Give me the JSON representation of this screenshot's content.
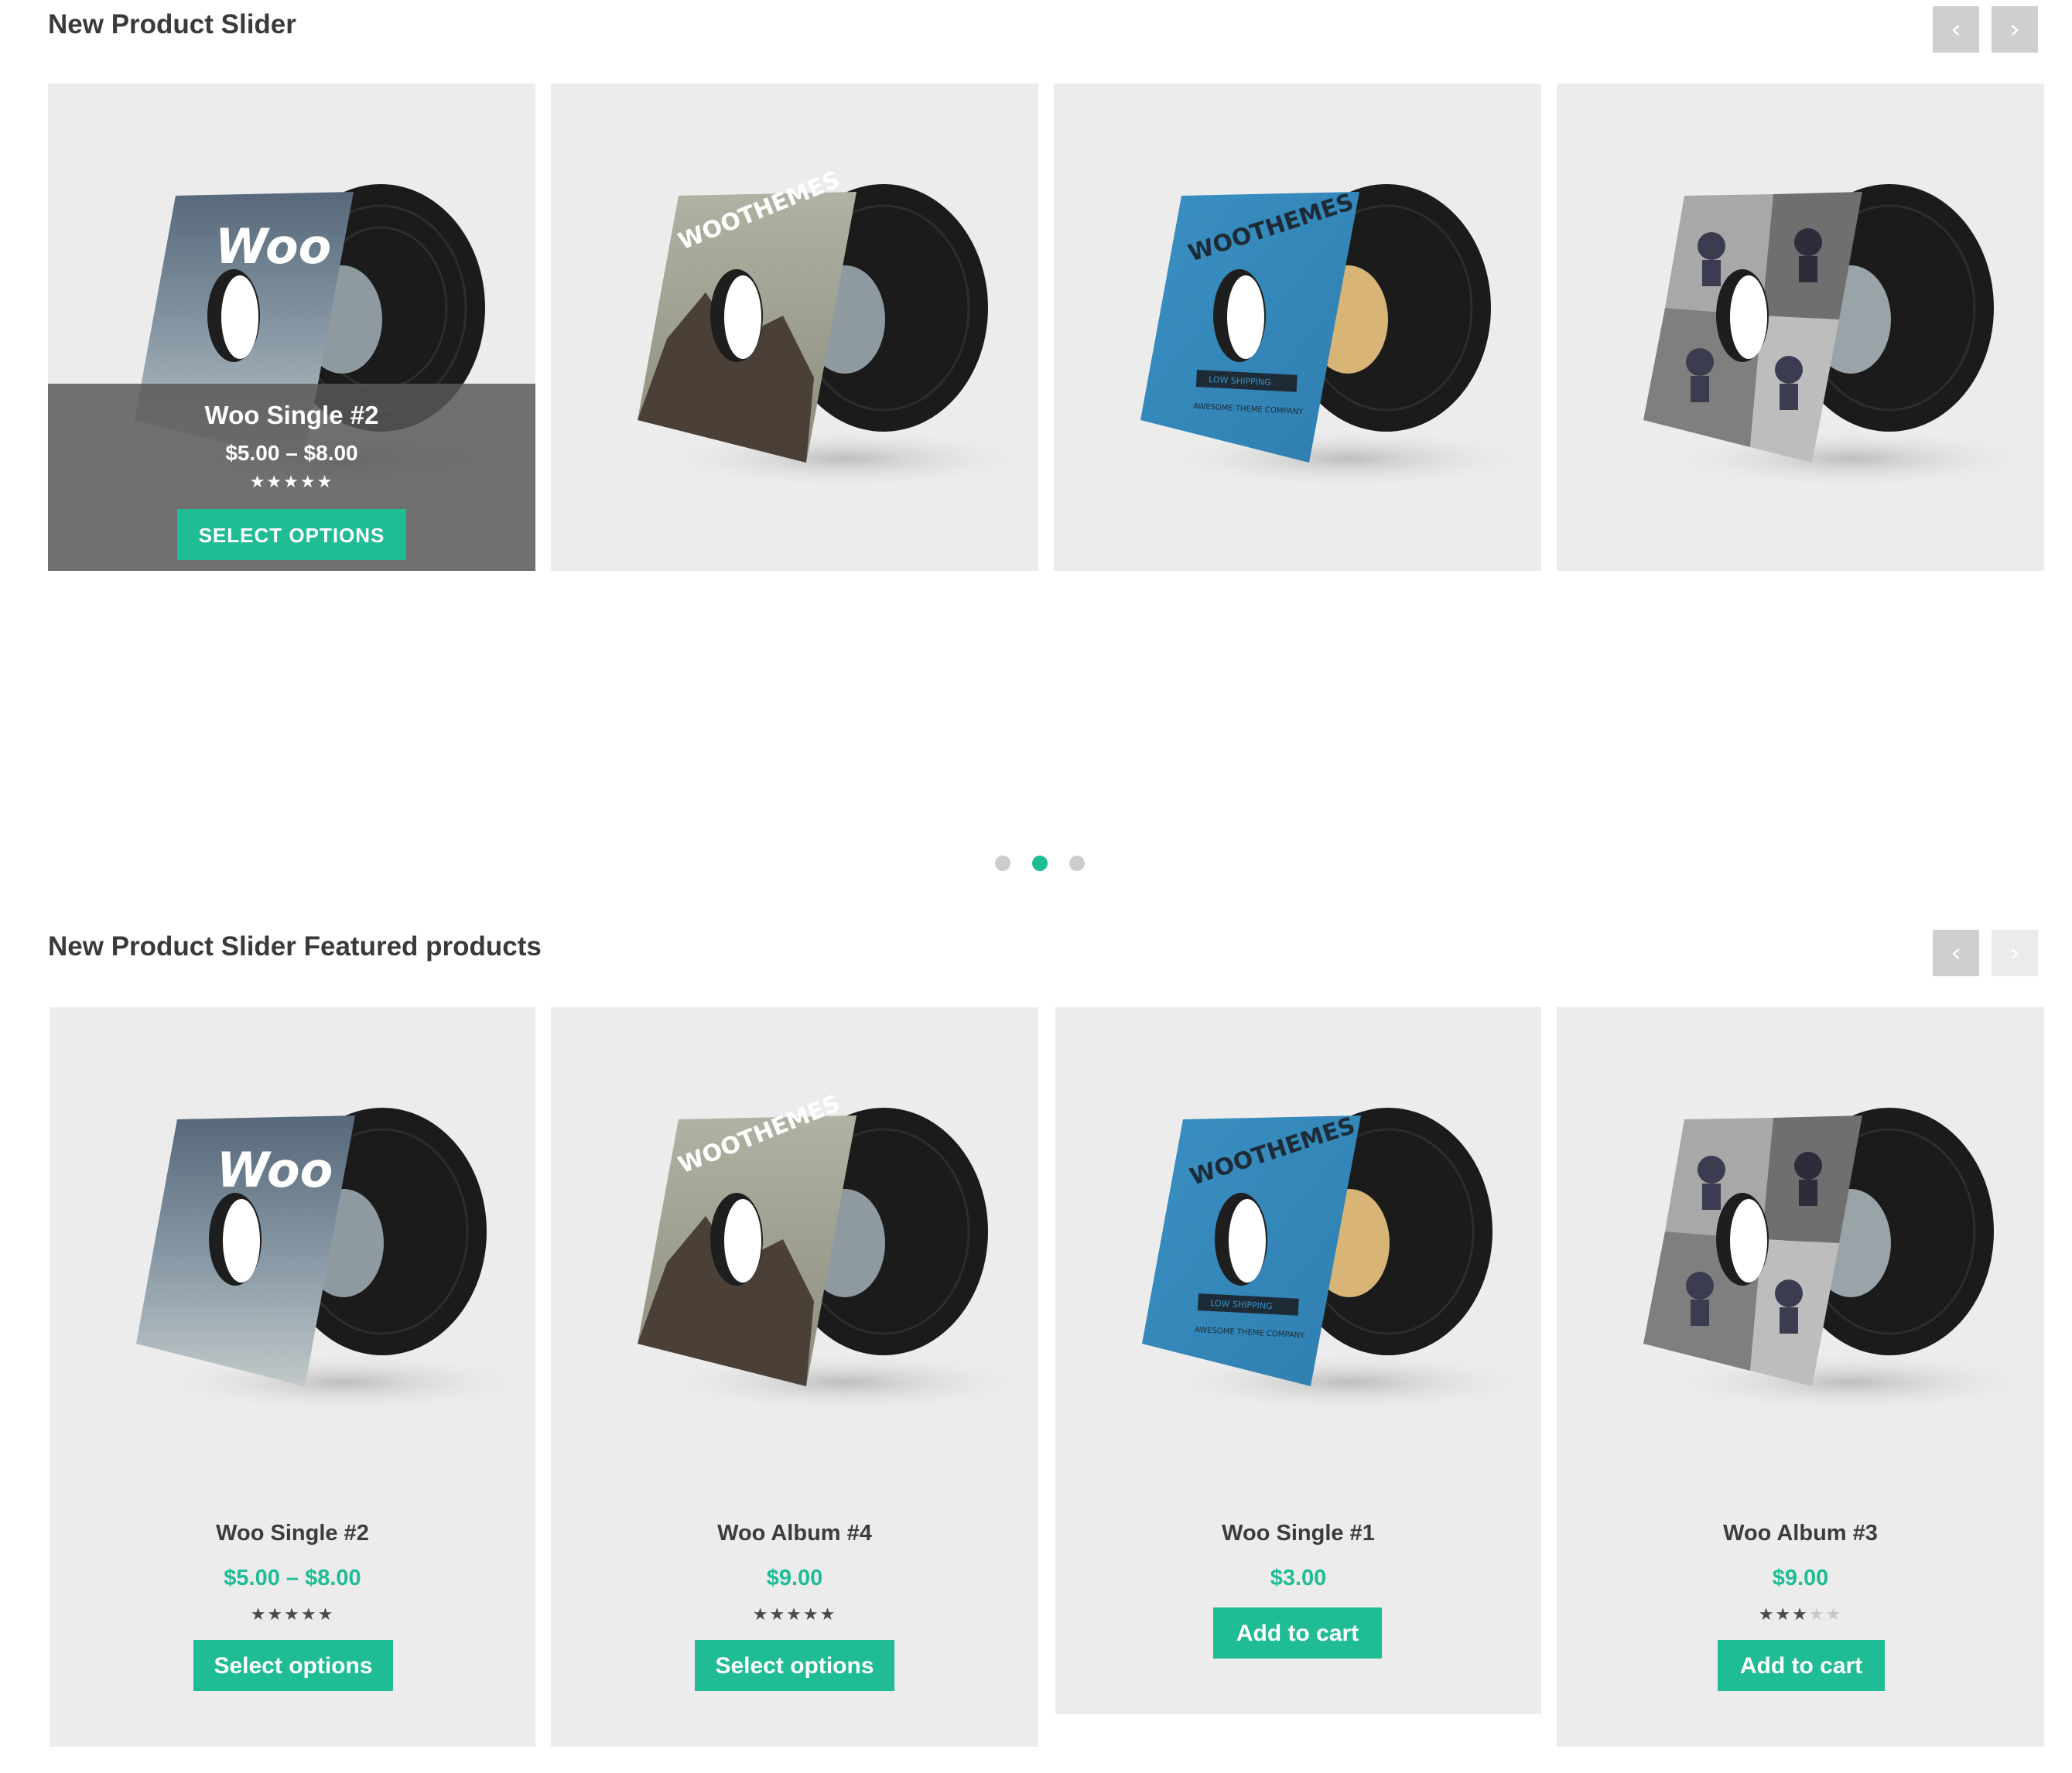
{
  "slider1": {
    "title": "New Product Slider",
    "prev_icon": "‹",
    "next_icon": "›",
    "hover_product": {
      "name": "Woo Single #2",
      "price": "$5.00 – $8.00",
      "rating": 4.5,
      "stars": "★★★★★",
      "button": "SELECT OPTIONS"
    },
    "products": [
      "woo-single-2",
      "woo-album-4",
      "woo-single-1",
      "woo-album-3"
    ]
  },
  "dots": {
    "count": 3,
    "active": 2
  },
  "slider2": {
    "title": "New Product Slider Featured products",
    "prev_icon": "‹",
    "next_icon": "›",
    "products": [
      {
        "name": "Woo Single #2",
        "price": "$5.00 – $8.00",
        "rating": 4.5,
        "stars": "★★★★★",
        "button": "Select options"
      },
      {
        "name": "Woo Album #4",
        "price": "$9.00",
        "rating": 5,
        "stars": "★★★★★",
        "button": "Select options"
      },
      {
        "name": "Woo Single #1",
        "price": "$3.00",
        "button": "Add to cart"
      },
      {
        "name": "Woo Album #3",
        "price": "$9.00",
        "rating": 3,
        "stars_on": "★★★",
        "stars_off": "★★",
        "button": "Add to cart"
      }
    ]
  },
  "cover_art": {
    "woo_single_2_text": "Woo",
    "woo_album_4_text": "WOOTHEMES",
    "woo_single_1_text": "WOOTHEMES",
    "woo_single_1_subtext": "AWESOME THEME COMPANY",
    "woo_single_1_banner": "LOW SHIPPING"
  },
  "colors": {
    "accent": "#1fbc96",
    "card_bg": "#ececec",
    "nav_button": "#cfcfcf",
    "dot_inactive": "#cccccc"
  }
}
